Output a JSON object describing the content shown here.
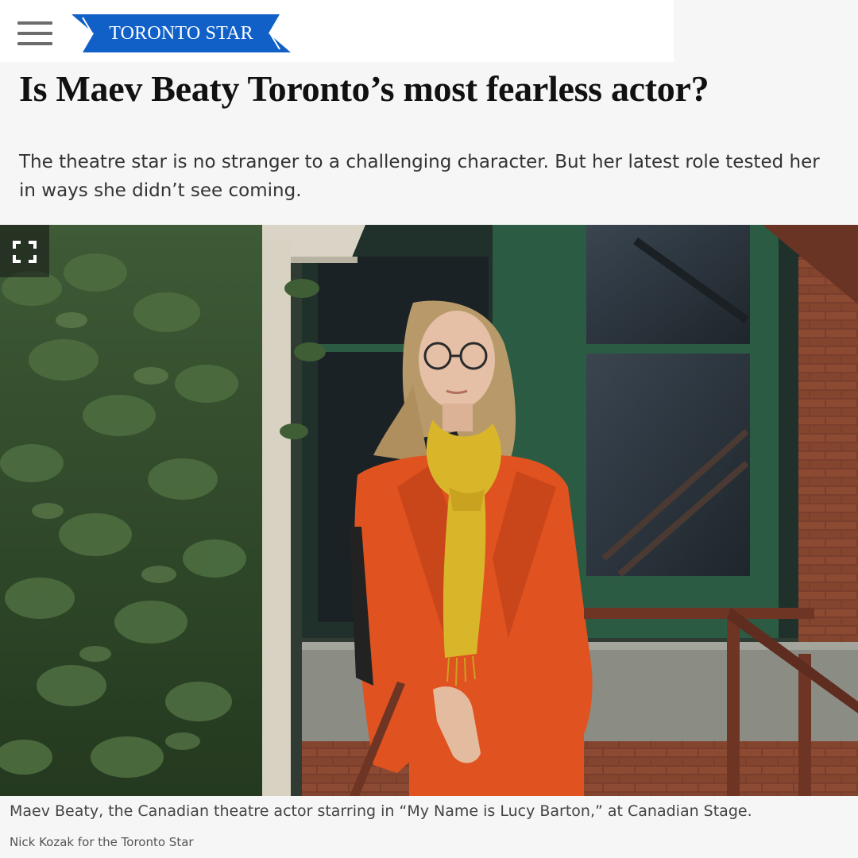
{
  "header": {
    "menu_icon": "hamburger-menu-icon",
    "logo_text": "TORONTO STAR",
    "brand_color": "#1160c8"
  },
  "article": {
    "headline": "Is Maev Beaty Toronto’s most fearless actor?",
    "dek": "The theatre star is no stranger to a challenging character. But her latest role tested her in ways she didn’t see coming.",
    "photo": {
      "expand_icon": "fullscreen-expand-icon",
      "caption": "Maev Beaty, the Canadian theatre actor starring in “My Name is Lucy Barton,” at Canadian Stage.",
      "credit": "Nick Kozak for the Toronto Star"
    }
  }
}
